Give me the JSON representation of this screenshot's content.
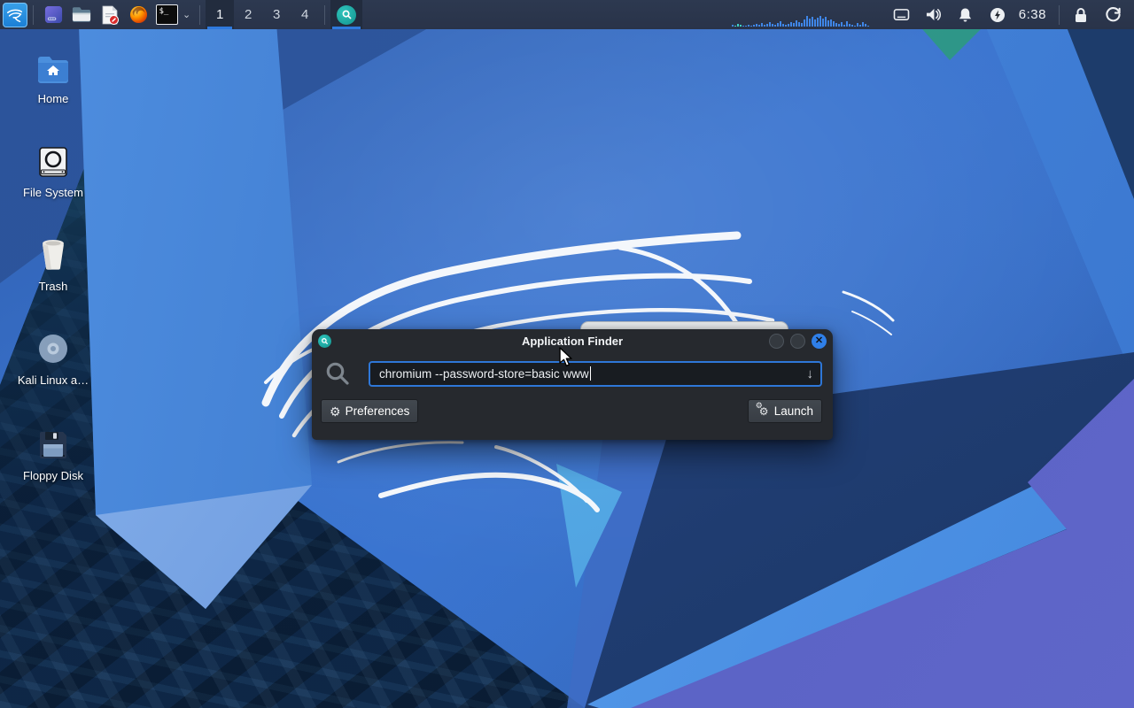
{
  "panel": {
    "terminal_glyph": "$_",
    "dropdown_chevron": "⌄",
    "workspaces": [
      {
        "label": "1",
        "active": true
      },
      {
        "label": "2",
        "active": false
      },
      {
        "label": "3",
        "active": false
      },
      {
        "label": "4",
        "active": false
      }
    ],
    "clock": "6:38",
    "cpu_bars": [
      2,
      1,
      3,
      2,
      1,
      1,
      2,
      1,
      2,
      3,
      2,
      4,
      2,
      3,
      5,
      3,
      2,
      4,
      6,
      3,
      2,
      3,
      5,
      4,
      7,
      5,
      4,
      8,
      12,
      9,
      11,
      8,
      10,
      12,
      9,
      11,
      7,
      8,
      6,
      4,
      3,
      5,
      2,
      6,
      3,
      2,
      1,
      4,
      2,
      5,
      3,
      1
    ],
    "cpu_teal_bars": [
      1,
      2,
      3
    ]
  },
  "desktop": {
    "icons": [
      {
        "label": "Home"
      },
      {
        "label": "File System"
      },
      {
        "label": "Trash"
      },
      {
        "label": "Kali Linux a…"
      },
      {
        "label": "Floppy Disk"
      }
    ]
  },
  "finder_dialog": {
    "title": "Application Finder",
    "query": "chromium --password-store=basic www",
    "dropdown_glyph": "↓",
    "close_glyph": "✕",
    "preferences_label": "Preferences",
    "launch_label": "Launch",
    "gear_glyph": "⚙"
  },
  "colors": {
    "accent_blue": "#2f7fe8",
    "teal": "#18a39f",
    "panel_bg": "#2b3548",
    "wallpaper_base": "#3b76d2"
  }
}
